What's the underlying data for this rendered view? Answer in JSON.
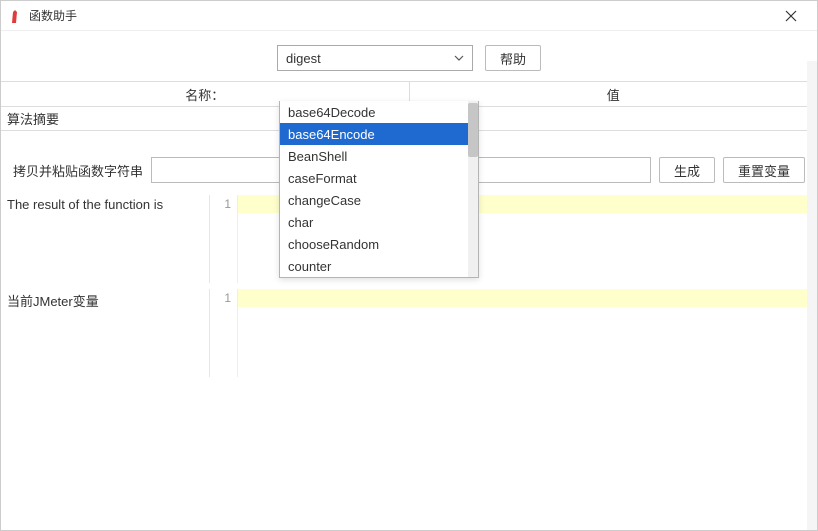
{
  "window": {
    "title": "函数助手"
  },
  "fnRow": {
    "selected": "digest",
    "helpButton": "帮助"
  },
  "dropdown": {
    "options": [
      "base64Decode",
      "base64Encode",
      "BeanShell",
      "caseFormat",
      "changeCase",
      "char",
      "chooseRandom",
      "counter"
    ],
    "selectedIndex": 1
  },
  "paramsTable": {
    "headers": {
      "name": "名称：",
      "value": "值"
    },
    "rows": [
      {
        "name": "算法摘要",
        "value": ""
      }
    ]
  },
  "copyRow": {
    "label": "拷贝并粘贴函数字符串",
    "value": "",
    "generate": "生成",
    "reset": "重置变量"
  },
  "resultSection": {
    "label": "The result of the function is",
    "lineNumber": "1"
  },
  "varsSection": {
    "label": "当前JMeter变量",
    "lineNumber": "1"
  }
}
